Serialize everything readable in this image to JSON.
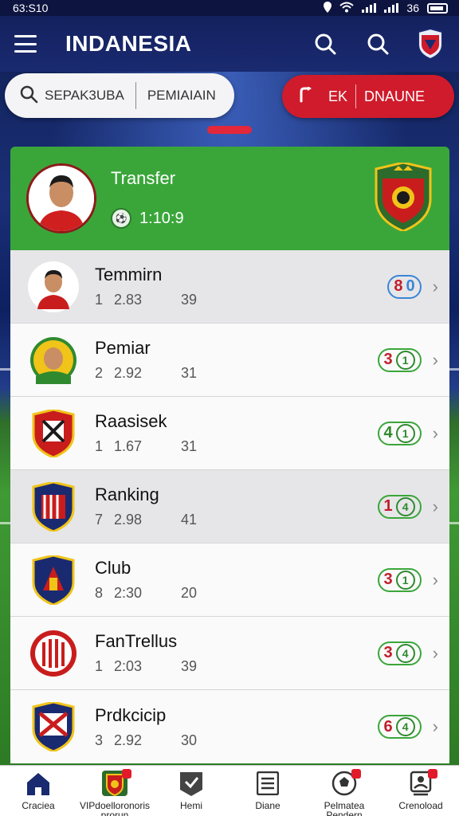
{
  "status_bar": {
    "time": "63:S10",
    "battery": "36"
  },
  "header": {
    "title": "INDANESIA"
  },
  "search": {
    "left_label": "SEPAK3UBA",
    "right_label": "PEMIAIAIN"
  },
  "live_button": {
    "left": "↑↓",
    "mid": "EK",
    "right": "DNAUNE"
  },
  "featured": {
    "title": "Transfer",
    "time": "1:10:9"
  },
  "rows": [
    {
      "name": "Temmirn",
      "num": "1",
      "stat1": "2.83",
      "stat2": "39",
      "score_a": "8",
      "score_b": "0"
    },
    {
      "name": "Pemiar",
      "num": "2",
      "stat1": "2.92",
      "stat2": "31",
      "score_a": "3",
      "score_b": "1"
    },
    {
      "name": "Raasisek",
      "num": "1",
      "stat1": "1.67",
      "stat2": "31",
      "score_a": "4",
      "score_b": "1"
    },
    {
      "name": "Ranking",
      "num": "7",
      "stat1": "2.98",
      "stat2": "41",
      "score_a": "1",
      "score_b": "4"
    },
    {
      "name": "Club",
      "num": "8",
      "stat1": "2:30",
      "stat2": "20",
      "score_a": "3",
      "score_b": "1"
    },
    {
      "name": "FanTrellus",
      "num": "1",
      "stat1": "2:03",
      "stat2": "39",
      "score_a": "3",
      "score_b": "4"
    },
    {
      "name": "Prdkcicip",
      "num": "3",
      "stat1": "2.92",
      "stat2": "30",
      "score_a": "6",
      "score_b": "4"
    }
  ],
  "nav": [
    {
      "label": "Craciea",
      "icon": "home-icon"
    },
    {
      "label": "VIPdoelloronoris prorun",
      "icon": "club-crest-icon",
      "badge": "1"
    },
    {
      "label": "Hemi",
      "icon": "check-board-icon"
    },
    {
      "label": "Diane",
      "icon": "list-icon"
    },
    {
      "label": "Pelmatea Pendern",
      "icon": "ball-icon"
    },
    {
      "label": "Crenoload",
      "icon": "profile-icon"
    }
  ],
  "colors": {
    "accent_red": "#cf1b2b",
    "header_blue": "#14215f",
    "featured_green": "#3aa63a"
  }
}
